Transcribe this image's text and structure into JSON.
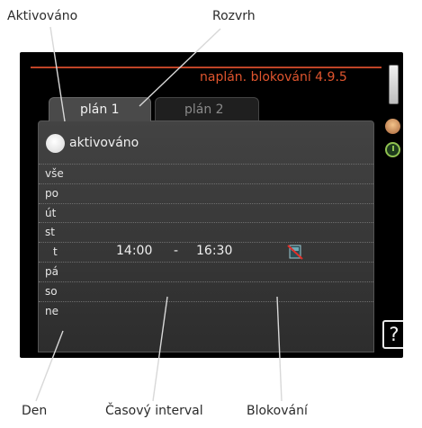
{
  "callouts": {
    "activated": "Aktivováno",
    "schedule": "Rozvrh",
    "day": "Den",
    "time_interval": "Časový interval",
    "blocking": "Blokování"
  },
  "screen": {
    "breadcrumb": "naplán. blokování  4.9.5",
    "tabs": [
      "plán 1",
      "plán 2"
    ],
    "active_tab": "plán 1",
    "toggle_label": "aktivováno",
    "toggle_on": false,
    "help_label": "?",
    "days": [
      "vše",
      "po",
      "út",
      "st",
      "t",
      "pá",
      "so",
      "ne"
    ],
    "entry": {
      "day": "t",
      "from": "14:00",
      "dash": "-",
      "to": "16:30",
      "block_icon": "heat-pump-blocked-icon"
    }
  },
  "colors": {
    "accent": "#e0552e",
    "line": "#c04427",
    "screen_bg": "#000000",
    "panel": "#3a3a3a"
  }
}
